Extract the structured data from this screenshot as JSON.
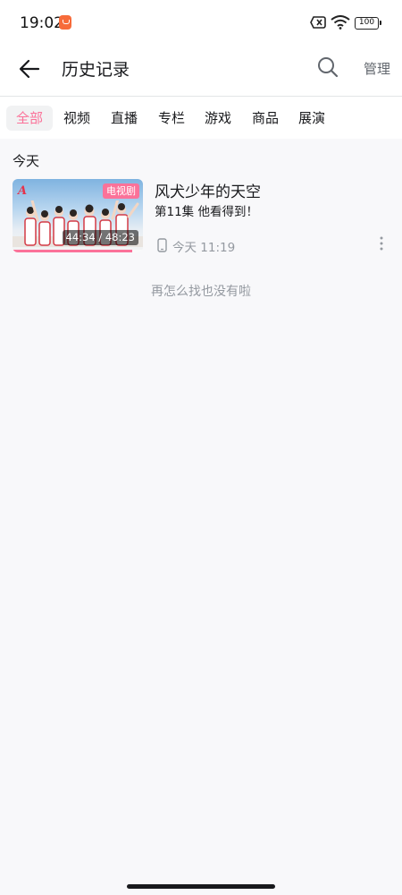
{
  "status_bar": {
    "time": "19:02",
    "battery_level": "100"
  },
  "header": {
    "title": "历史记录",
    "manage_label": "管理"
  },
  "tabs": [
    {
      "label": "全部",
      "active": true
    },
    {
      "label": "视频",
      "active": false
    },
    {
      "label": "直播",
      "active": false
    },
    {
      "label": "专栏",
      "active": false
    },
    {
      "label": "游戏",
      "active": false
    },
    {
      "label": "商品",
      "active": false
    },
    {
      "label": "展演",
      "active": false
    }
  ],
  "sections": [
    {
      "label": "今天",
      "items": [
        {
          "title": "风犬少年的天空",
          "subtitle": "第11集 他看得到！",
          "type_badge": "电视剧",
          "duration": "44:34 / 48:23",
          "progress": 0.92,
          "device": "phone-icon",
          "watch_time": "今天 11:19"
        }
      ]
    }
  ],
  "end_text": "再怎么找也没有啦",
  "colors": {
    "accent": "#fb7299",
    "secondary_text": "#9499a0",
    "background": "#f8f8fa"
  }
}
